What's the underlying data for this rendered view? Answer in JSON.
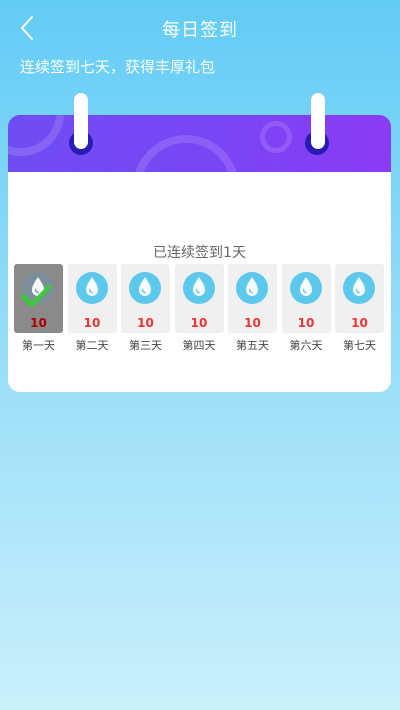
{
  "header": {
    "title": "每日签到",
    "back_icon": "chevron-left-icon"
  },
  "subtitle": "连续签到七天，获得丰厚礼包",
  "calendar": {
    "streak_text": "已连续签到1天",
    "colors": {
      "header_start": "#6f4df3",
      "header_end": "#8a3bf3",
      "drop": "#5bc8ec",
      "points": "#e33333"
    },
    "days": [
      {
        "label": "第一天",
        "points": "10",
        "checked": true
      },
      {
        "label": "第二天",
        "points": "10",
        "checked": false
      },
      {
        "label": "第三天",
        "points": "10",
        "checked": false
      },
      {
        "label": "第四天",
        "points": "10",
        "checked": false
      },
      {
        "label": "第五天",
        "points": "10",
        "checked": false
      },
      {
        "label": "第六天",
        "points": "10",
        "checked": false
      },
      {
        "label": "第七天",
        "points": "10",
        "checked": false
      }
    ]
  }
}
